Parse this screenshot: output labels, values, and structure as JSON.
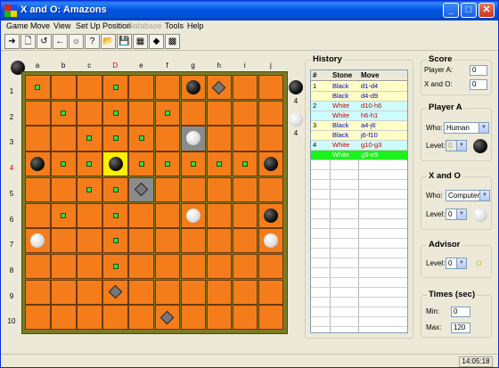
{
  "window": {
    "title": "X and O: Amazons"
  },
  "titlebar": {
    "minimize": "_",
    "maximize": "□",
    "close": "✕"
  },
  "menu": [
    {
      "label": "Game",
      "disabled": false
    },
    {
      "label": "Move",
      "disabled": false
    },
    {
      "label": "View",
      "disabled": false
    },
    {
      "label": "Set Up Position",
      "disabled": false
    },
    {
      "label": "Database",
      "disabled": true
    },
    {
      "label": "Tools",
      "disabled": false
    },
    {
      "label": "Help",
      "disabled": false
    }
  ],
  "toolbar": [
    {
      "icon": "move-arrow-icon",
      "glyph": "➜"
    },
    {
      "icon": "new-game-icon",
      "glyph": "🗋"
    },
    {
      "icon": "undo-icon",
      "glyph": "↺"
    },
    {
      "icon": "back-icon",
      "glyph": "←"
    },
    {
      "icon": "settings-sun-icon",
      "glyph": "☼"
    },
    {
      "icon": "hint-icon",
      "glyph": "?"
    },
    {
      "icon": "open-icon",
      "glyph": "📂"
    },
    {
      "icon": "save-icon",
      "glyph": "💾"
    },
    {
      "icon": "database-icon",
      "glyph": "▦"
    },
    {
      "icon": "erase-icon",
      "glyph": "◆"
    },
    {
      "icon": "board-color-icon",
      "glyph": "▩"
    }
  ],
  "board": {
    "columns": [
      "a",
      "b",
      "c",
      "D",
      "e",
      "f",
      "g",
      "h",
      "i",
      "j"
    ],
    "rows": [
      "1",
      "2",
      "3",
      "4",
      "5",
      "6",
      "7",
      "8",
      "9",
      "10"
    ],
    "active_column": "D",
    "active_row": "4",
    "stones": [
      {
        "cell": "g1",
        "color": "black"
      },
      {
        "cell": "g3",
        "color": "white"
      },
      {
        "cell": "a4",
        "color": "black"
      },
      {
        "cell": "d4",
        "color": "black"
      },
      {
        "cell": "j4",
        "color": "black"
      },
      {
        "cell": "g6",
        "color": "white"
      },
      {
        "cell": "j6",
        "color": "black"
      },
      {
        "cell": "a7",
        "color": "white"
      },
      {
        "cell": "j7",
        "color": "white"
      }
    ],
    "arrows": [
      "h1",
      "e5",
      "d9",
      "f10"
    ],
    "gray_cells": [
      "g3",
      "e5"
    ],
    "highlight_cells": [
      "d4"
    ],
    "marks": [
      "a1",
      "d1",
      "b2",
      "d2",
      "f2",
      "c3",
      "d3",
      "e3",
      "b4",
      "c4",
      "e4",
      "f4",
      "g4",
      "h4",
      "i4",
      "c5",
      "d5",
      "b6",
      "d6",
      "d7",
      "d8"
    ]
  },
  "side_counts": {
    "black": "4",
    "white": "4"
  },
  "history": {
    "title": "History",
    "columns": [
      "#",
      "Stone",
      "Move"
    ],
    "rows": [
      {
        "num": "1",
        "stone": "Black",
        "move": "d1-d4",
        "bg": "yellow"
      },
      {
        "num": "",
        "stone": "Black",
        "move": "d4-d9",
        "bg": "yellow"
      },
      {
        "num": "2",
        "stone": "White",
        "move": "d10-h6",
        "bg": "cyan"
      },
      {
        "num": "",
        "stone": "White",
        "move": "h6-h1",
        "bg": "cyan"
      },
      {
        "num": "3",
        "stone": "Black",
        "move": "a4-j6",
        "bg": "yellow"
      },
      {
        "num": "",
        "stone": "Black",
        "move": "j6-f10",
        "bg": "yellow"
      },
      {
        "num": "4",
        "stone": "White",
        "move": "g10-g3",
        "bg": "cyan"
      },
      {
        "num": "",
        "stone": "White",
        "move": "g3-e5",
        "bg": "green"
      }
    ]
  },
  "score": {
    "title": "Score",
    "player_a_label": "Player A:",
    "player_a_value": "0",
    "xo_label": "X and O:",
    "xo_value": "0"
  },
  "player_a": {
    "title": "Player A",
    "who_label": "Who:",
    "who_value": "Human",
    "level_label": "Level:",
    "level_value": "0"
  },
  "xando": {
    "title": "X and O",
    "who_label": "Who:",
    "who_value": "Computer",
    "level_label": "Level:",
    "level_value": "0"
  },
  "advisor": {
    "title": "Advisor",
    "level_label": "Level:",
    "level_value": "0"
  },
  "times": {
    "title": "Times (sec)",
    "min_label": "Min:",
    "min_value": "0",
    "max_label": "Max:",
    "max_value": "120"
  },
  "status": {
    "clock": "14:05:18"
  }
}
